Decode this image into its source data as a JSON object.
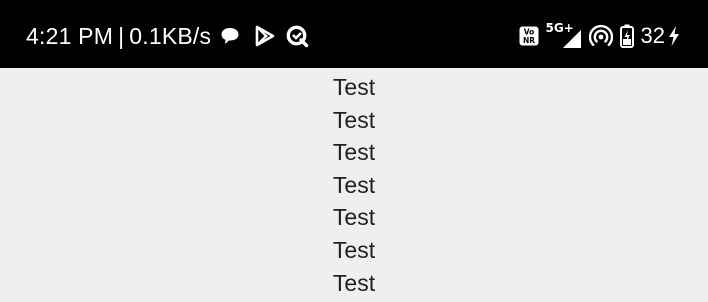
{
  "status_bar": {
    "time": "4:21 PM",
    "network_speed": "0.1KB/s",
    "separator": "|",
    "left_icons": [
      "chat-bubble-icon",
      "play-store-icon",
      "q-app-icon"
    ],
    "right_icons": [
      "vonr-icon",
      "signal-5g-plus-icon",
      "hotspot-icon",
      "battery-icon"
    ],
    "signal_label": "5G+",
    "battery_level": "32",
    "charging": true,
    "background": "#000000"
  },
  "content": {
    "items": [
      "Test",
      "Test",
      "Test",
      "Test",
      "Test",
      "Test",
      "Test"
    ],
    "background": "#efefef"
  }
}
